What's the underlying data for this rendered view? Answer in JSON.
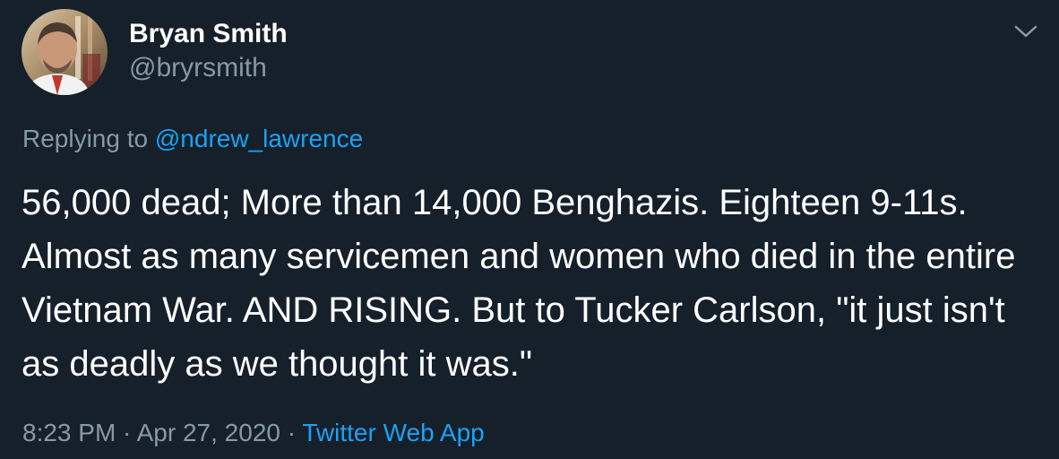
{
  "tweet": {
    "author": {
      "display_name": "Bryan Smith",
      "handle": "@bryrsmith"
    },
    "reply": {
      "prefix": "Replying to ",
      "mention": "@ndrew_lawrence"
    },
    "text": "56,000 dead; More than 14,000 Benghazis. Eighteen 9-11s. Almost as many servicemen and women who died in the entire Vietnam War. AND RISING. But to Tucker Carlson, \"it just isn't as deadly as we thought it was.\"",
    "time": "8:23 PM",
    "separator": " · ",
    "date": "Apr 27, 2020",
    "separator2": " · ",
    "source": "Twitter Web App"
  },
  "icons": {
    "menu": "chevron-down-icon",
    "avatar": "profile-photo"
  },
  "colors": {
    "background": "#15202b",
    "text": "#ffffff",
    "secondary": "#8899a6",
    "link": "#1da1f2"
  }
}
